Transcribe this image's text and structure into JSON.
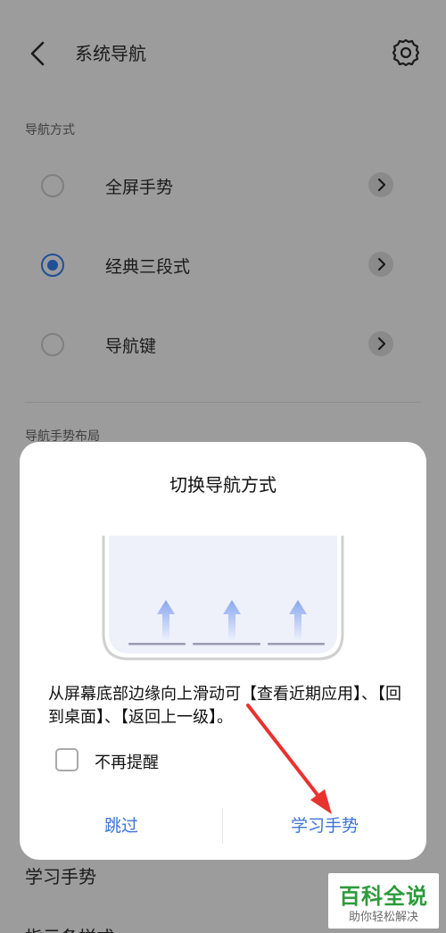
{
  "header": {
    "title": "系统导航"
  },
  "nav_method": {
    "section_label": "导航方式",
    "options": [
      {
        "label": "全屏手势",
        "selected": false
      },
      {
        "label": "经典三段式",
        "selected": true
      },
      {
        "label": "导航键",
        "selected": false
      }
    ]
  },
  "gesture_layout": {
    "section_label": "导航手势布局"
  },
  "below_items": {
    "learn": "学习手势",
    "partial": "指示条样式"
  },
  "dialog": {
    "title": "切换导航方式",
    "description": "从屏幕底部边缘向上滑动可【查看近期应用】、【回到桌面】、【返回上一级】。",
    "checkbox_label": "不再提醒",
    "checkbox_checked": false,
    "skip_button": "跳过",
    "learn_button": "学习手势"
  },
  "watermark": {
    "main": "百科全说",
    "sub": "助你轻松解决"
  },
  "colors": {
    "accent": "#3b73d9",
    "annotation": "#e8322f",
    "watermark": "#2c9b3a"
  }
}
